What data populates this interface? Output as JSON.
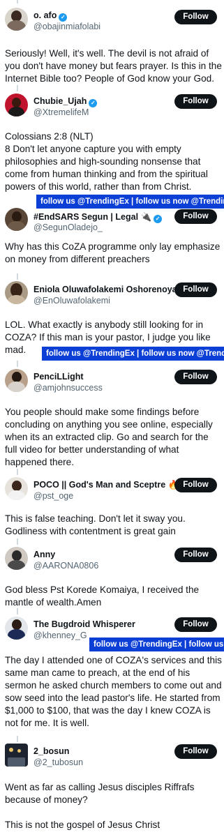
{
  "follow_label": "Follow",
  "watermark_text": "follow us @TrendingEx | follow us now @TrendingEx",
  "posts": [
    {
      "name": "o. afo",
      "handle": "@obajinmiafolabi",
      "verified": true,
      "text": "Seriously! Well, it's well. The devil is not afraid of you don't have money but fears prayer. Is this in the Internet Bible too? People of God know your God."
    },
    {
      "name": "Chubie_Ujah",
      "handle": "@XtremelifeM",
      "verified": true,
      "text": "Colossians 2:8 (NLT)\n8 Don't let anyone capture you with empty philosophies and high-sounding nonsense that come from human thinking and from the spiritual powers of this world, rather than from Christ."
    },
    {
      "name": "#EndSARS Segun | Legal 🔌",
      "handle": "@SegunOladejo_",
      "verified": true,
      "text": "Why has this CoZA programme only lay emphasize on money from different preachers"
    },
    {
      "name": "Eniola Oluwafolakemi Oshorenoya",
      "handle": "@EnOluwafolakemi",
      "verified": false,
      "text": "LOL. What exactly is anybody still looking for in COZA? If this man is your pastor, I judge you like mad."
    },
    {
      "name": "PenciLLight",
      "handle": "@amjohnsuccess",
      "verified": false,
      "text": "You people should make some findings before concluding on anything you see online, especially when its an extracted clip. Go and search for the full video for better understanding of what happened there."
    },
    {
      "name": "POCO || God's Man and Sceptre 🔥",
      "handle": "@pst_oge",
      "verified": true,
      "text": "This is false teaching. Don't let it sway you. Godliness with contentment is great gain"
    },
    {
      "name": "Anny",
      "handle": "@AARONA0806",
      "verified": false,
      "text": "God bless Pst Korede Komaiya, I received the mantle of wealth.Amen"
    },
    {
      "name": "The Bugdroid Whisperer",
      "handle": "@khenney_G",
      "verified": false,
      "text": "The day I attended one of COZA's services and this same man came to preach, at the end of his sermon he asked church members to come out and sow seed into the lead pastor's life. He started from $1,000 to $100, that was the day I knew COZA is not for me. It is well."
    },
    {
      "name": "2_bosun",
      "handle": "@2_tubosun",
      "verified": false,
      "text": "Went as far as calling Jesus disciples Riffrafs because of money?\n\nThis is not the gospel of Jesus Christ"
    }
  ]
}
